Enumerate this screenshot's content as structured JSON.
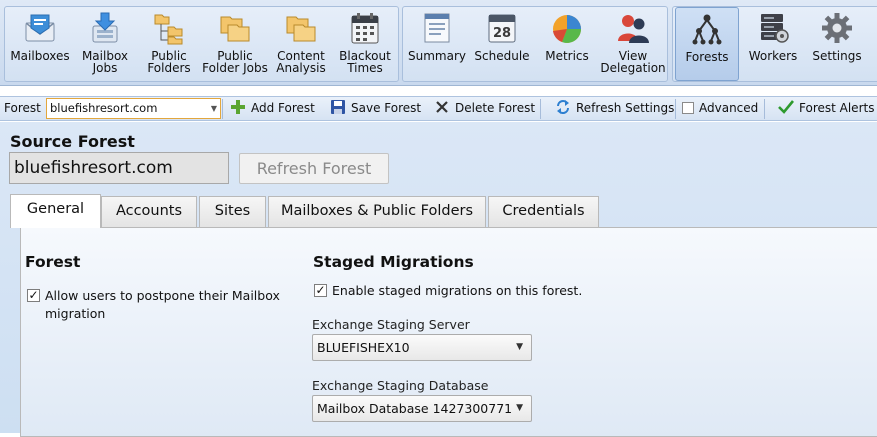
{
  "ribbon": {
    "buttons": [
      {
        "label": "Mailboxes",
        "icon": "mailboxes-icon"
      },
      {
        "label": "Mailbox\nJobs",
        "icon": "mailbox-jobs-icon"
      },
      {
        "label": "Public\nFolders",
        "icon": "public-folders-icon"
      },
      {
        "label": "Public\nFolder Jobs",
        "icon": "public-folder-jobs-icon"
      },
      {
        "label": "Content\nAnalysis",
        "icon": "content-analysis-icon"
      },
      {
        "label": "Blackout\nTimes",
        "icon": "blackout-times-icon"
      },
      {
        "label": "Summary",
        "icon": "summary-icon"
      },
      {
        "label": "Schedule",
        "icon": "schedule-icon",
        "calendar_day": "28"
      },
      {
        "label": "Metrics",
        "icon": "metrics-icon"
      },
      {
        "label": "View\nDelegation",
        "icon": "view-delegation-icon"
      },
      {
        "label": "Forests",
        "icon": "forests-icon",
        "active": true
      },
      {
        "label": "Workers",
        "icon": "workers-icon"
      },
      {
        "label": "Settings",
        "icon": "settings-icon"
      }
    ]
  },
  "toolbar": {
    "forest_label": "Forest",
    "forest_value": "bluefishresort.com",
    "add_forest": "Add Forest",
    "save_forest": "Save Forest",
    "delete_forest": "Delete Forest",
    "refresh_settings": "Refresh Settings",
    "advanced": "Advanced",
    "advanced_checked": false,
    "forest_alerts": "Forest Alerts"
  },
  "source": {
    "title": "Source Forest",
    "value": "bluefishresort.com",
    "refresh_button": "Refresh Forest"
  },
  "tabs": [
    "General",
    "Accounts",
    "Sites",
    "Mailboxes & Public Folders",
    "Credentials"
  ],
  "active_tab": "General",
  "general": {
    "forest_heading": "Forest",
    "postpone_label": "Allow users to postpone their Mailbox\nmigration",
    "postpone_checked": true,
    "staged_heading": "Staged Migrations",
    "staged_label": "Enable staged migrations on this forest.",
    "staged_checked": true,
    "server_label": "Exchange Staging Server",
    "server_value": "BLUEFISHEX10",
    "database_label": "Exchange Staging Database",
    "database_value": "Mailbox Database 1427300771"
  },
  "colors": {
    "ribbon_bg": "#d3e1f2",
    "content_bg": "#d6e4f5",
    "combo_focus_border": "#e3a73d",
    "add_icon": "#5aa532",
    "alerts_check": "#2e9a2e"
  }
}
